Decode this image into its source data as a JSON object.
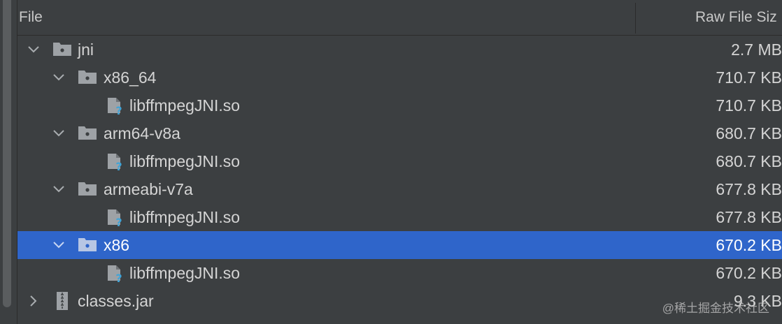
{
  "header": {
    "file_col": "File",
    "size_col": "Raw File Siz"
  },
  "rows": [
    {
      "name": "jni",
      "size": "2.7 MB",
      "type": "folder",
      "expanded": true
    },
    {
      "name": "x86_64",
      "size": "710.7 KB",
      "type": "folder",
      "expanded": true
    },
    {
      "name": "libffmpegJNI.so",
      "size": "710.7 KB",
      "type": "file-unknown"
    },
    {
      "name": "arm64-v8a",
      "size": "680.7 KB",
      "type": "folder",
      "expanded": true
    },
    {
      "name": "libffmpegJNI.so",
      "size": "680.7 KB",
      "type": "file-unknown"
    },
    {
      "name": "armeabi-v7a",
      "size": "677.8 KB",
      "type": "folder",
      "expanded": true
    },
    {
      "name": "libffmpegJNI.so",
      "size": "677.8 KB",
      "type": "file-unknown"
    },
    {
      "name": "x86",
      "size": "670.2 KB",
      "type": "folder",
      "expanded": true,
      "selected": true
    },
    {
      "name": "libffmpegJNI.so",
      "size": "670.2 KB",
      "type": "file-unknown"
    },
    {
      "name": "classes.jar",
      "size": "9.3 KB",
      "type": "jar",
      "expanded": false
    }
  ],
  "watermark": "@稀土掘金技术社区",
  "colors": {
    "background": "#3c3f41",
    "selection": "#2f65ca",
    "icon_gray": "#9ea2a6",
    "question_blue": "#3fa4d8"
  }
}
